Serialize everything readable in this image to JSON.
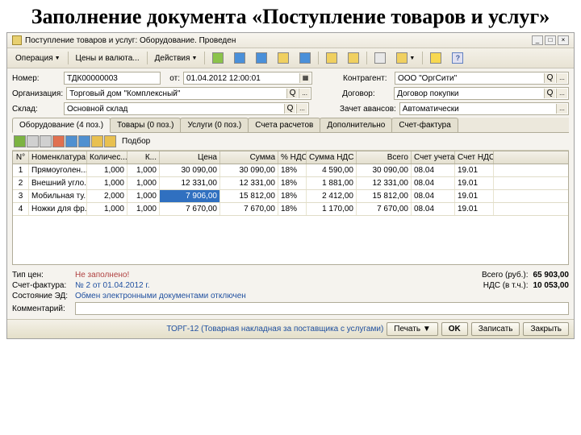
{
  "slide_title": "Заполнение документа «Поступление товаров и услуг»",
  "window": {
    "title": "Поступление товаров и услуг: Оборудование. Проведен"
  },
  "toolbar": {
    "operation": "Операция",
    "prices": "Цены и валюта...",
    "actions": "Действия"
  },
  "header": {
    "number_lbl": "Номер:",
    "number": "ТДК00000003",
    "date_lbl": "от:",
    "date": "01.04.2012 12:00:01",
    "contr_lbl": "Контрагент:",
    "contr": "ООО \"ОргСити\"",
    "org_lbl": "Организация:",
    "org": "Торговый дом \"Комплексный\"",
    "dog_lbl": "Договор:",
    "dog": "Договор покупки",
    "sklad_lbl": "Склад:",
    "sklad": "Основной склад",
    "zach_lbl": "Зачет авансов:",
    "zach": "Автоматически"
  },
  "tabs": [
    "Оборудование (4 поз.)",
    "Товары (0 поз.)",
    "Услуги (0 поз.)",
    "Счета расчетов",
    "Дополнительно",
    "Счет-фактура"
  ],
  "subtb": {
    "podbor": "Подбор"
  },
  "cols": [
    "N°",
    "Номенклатура",
    "Количес...",
    "К...",
    "Цена",
    "Сумма",
    "% НДС",
    "Сумма НДС",
    "Всего",
    "Счет учета",
    "Счет НДС"
  ],
  "rows": [
    {
      "n": "1",
      "nom": "Прямоуголен...",
      "qty": "1,000",
      "k": "1,000",
      "price": "30 090,00",
      "sum": "30 090,00",
      "vat": "18%",
      "vsum": "4 590,00",
      "total": "30 090,00",
      "acc": "08.04",
      "accv": "19.01"
    },
    {
      "n": "2",
      "nom": "Внешний угло...",
      "qty": "1,000",
      "k": "1,000",
      "price": "12 331,00",
      "sum": "12 331,00",
      "vat": "18%",
      "vsum": "1 881,00",
      "total": "12 331,00",
      "acc": "08.04",
      "accv": "19.01"
    },
    {
      "n": "3",
      "nom": "Мобильная ту...",
      "qty": "2,000",
      "k": "1,000",
      "price": "7 906,00",
      "sum": "15 812,00",
      "vat": "18%",
      "vsum": "2 412,00",
      "total": "15 812,00",
      "acc": "08.04",
      "accv": "19.01",
      "sel": true
    },
    {
      "n": "4",
      "nom": "Ножки для фр...",
      "qty": "1,000",
      "k": "1,000",
      "price": "7 670,00",
      "sum": "7 670,00",
      "vat": "18%",
      "vsum": "1 170,00",
      "total": "7 670,00",
      "acc": "08.04",
      "accv": "19.01"
    }
  ],
  "footer": {
    "tip_lbl": "Тип цен:",
    "tip": "Не заполнено!",
    "sf_lbl": "Счет-фактура:",
    "sf": "№ 2 от 01.04.2012 г.",
    "ed_lbl": "Состояние ЭД:",
    "ed": "Обмен электронными документами отключен",
    "com_lbl": "Комментарий:",
    "total_lbl": "Всего (руб.):",
    "total": "65 903,00",
    "nds_lbl": "НДС (в т.ч.):",
    "nds": "10 053,00"
  },
  "btns": {
    "torg": "ТОРГ-12 (Товарная накладная за поставщика с услугами)",
    "print": "Печать",
    "ok": "OK",
    "write": "Записать",
    "close": "Закрыть"
  }
}
